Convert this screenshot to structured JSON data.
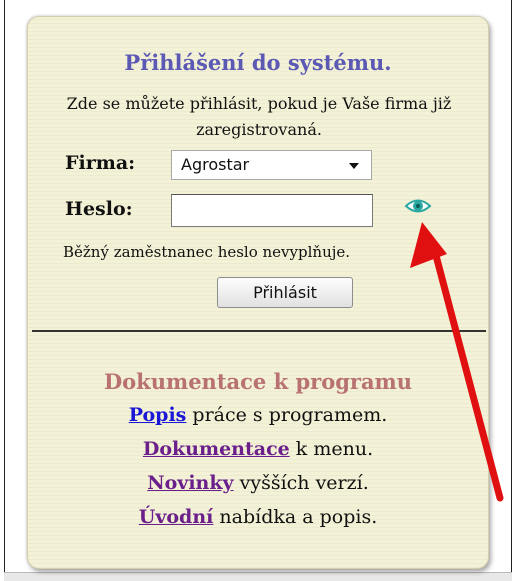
{
  "login": {
    "title": "Přihlášení do systému.",
    "intro": "Zde se můžete přihlásit, pokud je Vaše firma již zaregistrovaná.",
    "firma_label": "Firma:",
    "firma_value": "Agrostar",
    "heslo_label": "Heslo:",
    "heslo_value": "",
    "note": "Běžný zaměstnanec heslo nevyplňuje.",
    "submit_label": "Přihlásit",
    "eye_icon": "eye-icon"
  },
  "docs": {
    "title": "Dokumentace k programu",
    "items": [
      {
        "link": "Popis",
        "text": " práce s programem."
      },
      {
        "link": "Dokumentace",
        "text": " k menu."
      },
      {
        "link": "Novinky",
        "text": " vyšších verzí."
      },
      {
        "link": "Úvodní",
        "text": " nabídka a popis."
      }
    ]
  },
  "colors": {
    "panel_bg": "#f3f1d6",
    "title": "#5b59b3",
    "docs_title": "#b87272",
    "link_blue": "#1a17d6",
    "link_purple": "#6a1f8a",
    "arrow": "#e01010",
    "eye": "#2aa7a0"
  }
}
